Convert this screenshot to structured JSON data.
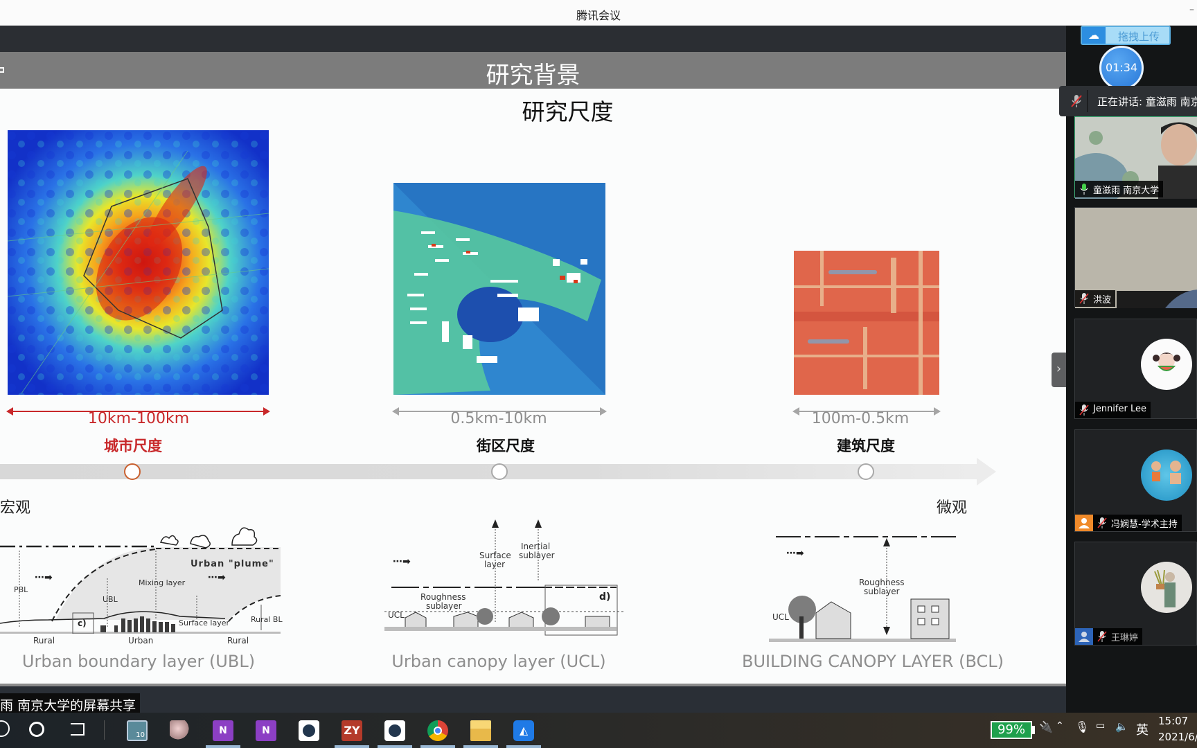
{
  "window": {
    "title": "腾讯会议"
  },
  "slide": {
    "header": "研究背景",
    "subtitle": "研究尺度",
    "scales": [
      {
        "range": "10km-100km",
        "label": "城市尺度",
        "active": true,
        "image": "urban-heat-map"
      },
      {
        "range": "0.5km-10km",
        "label": "街区尺度",
        "active": false,
        "image": "block-heat-map"
      },
      {
        "range": "100m-0.5km",
        "label": "建筑尺度",
        "active": false,
        "image": "building-heat-map"
      }
    ],
    "axis_left": "宏观",
    "axis_right": "微观",
    "diagrams": [
      {
        "caption": "Urban boundary layer (UBL)",
        "labels": {
          "pbl": "PBL",
          "ubl": "UBL",
          "mixing": "Mixing layer",
          "plume": "Urban  \"plume\"",
          "surface": "Surface layer",
          "rural_bl": "Rural BL",
          "box": "c)",
          "rural1": "Rural",
          "urban": "Urban",
          "rural2": "Rural"
        }
      },
      {
        "caption": "Urban canopy layer (UCL)",
        "labels": {
          "surface": "Surface",
          "layer": "layer",
          "inertial": "Inertial",
          "sublayer": "sublayer",
          "roughness": "Roughness",
          "rsub": "sublayer",
          "ucl": "UCL",
          "box": "d)"
        }
      },
      {
        "caption": "BUILDING CANOPY LAYER (BCL)",
        "labels": {
          "roughness": "Roughness",
          "rsub": "sublayer",
          "ucl": "UCL"
        }
      }
    ],
    "colors": {
      "active": "#c8282a",
      "inactive": "#8e8e8e"
    }
  },
  "share_label": "南京大学的屏幕共享",
  "share_prefix": "雨",
  "meeting": {
    "upload_label": "拖拽上传",
    "timer": "01:34",
    "speaking": "正在讲话: 童滋雨 南京",
    "participants": [
      {
        "name": "童滋雨 南京大学",
        "mic": "on",
        "video": true
      },
      {
        "name": "洪波",
        "mic": "muted",
        "video": true
      },
      {
        "name": "Jennifer Lee",
        "mic": "muted",
        "video": false
      },
      {
        "name": "冯娴慧-学术主持",
        "mic": "muted",
        "video": false,
        "role": "host"
      },
      {
        "name": "王琳婷",
        "mic": "muted",
        "video": false,
        "role": "member"
      }
    ]
  },
  "taskbar": {
    "apps": [
      "search",
      "cortana",
      "task-view",
      "app-10",
      "snipping-tool",
      "onenote",
      "onenote-2",
      "app-blue",
      "zotero",
      "app-blue-2",
      "chrome",
      "file-explorer",
      "tencent-meeting"
    ],
    "battery": "99%",
    "ime": "英",
    "time": "15:07",
    "date": "2021/6/"
  }
}
